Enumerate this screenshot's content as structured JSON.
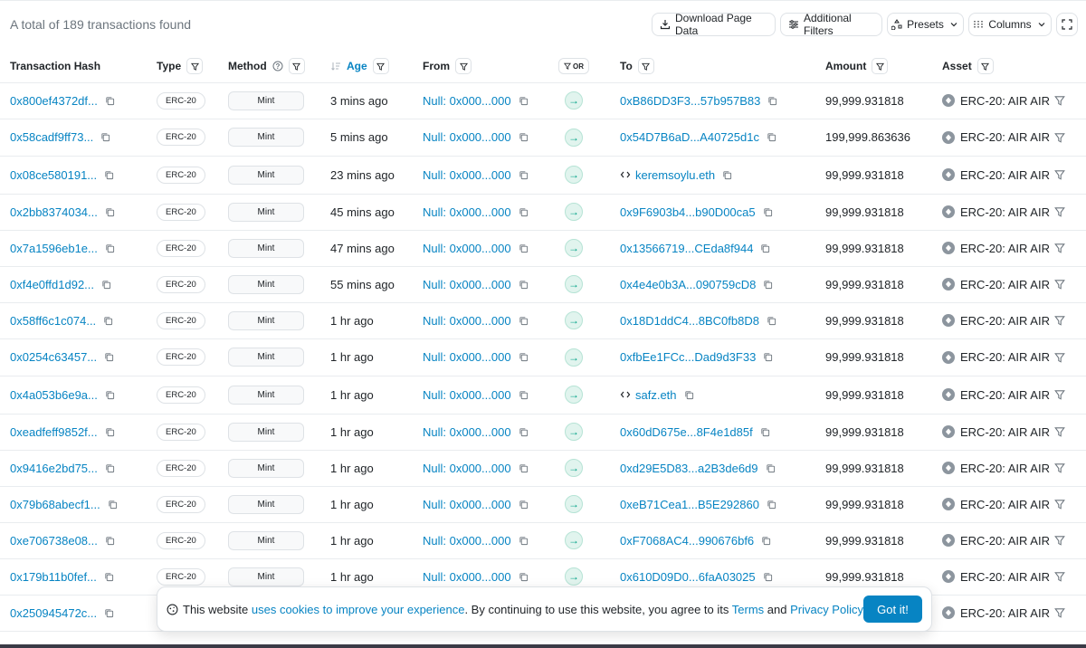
{
  "summary": "A total of 189 transactions found",
  "toolbar": {
    "download": "Download Page Data",
    "filters": "Additional Filters",
    "presets": "Presets",
    "columns": "Columns"
  },
  "columns": {
    "hash": "Transaction Hash",
    "type": "Type",
    "method": "Method",
    "age": "Age",
    "from": "From",
    "or": "OR",
    "to": "To",
    "amount": "Amount",
    "asset": "Asset"
  },
  "rows": [
    {
      "hash": "0x800ef4372df...",
      "type": "ERC-20",
      "method": "Mint",
      "age": "3 mins ago",
      "from": "Null: 0x000...000",
      "to": "0xB86DD3F3...57b957B83",
      "to_ens": false,
      "amount": "99,999.931818",
      "asset": "ERC-20: AIR AIR"
    },
    {
      "hash": "0x58cadf9ff73...",
      "type": "ERC-20",
      "method": "Mint",
      "age": "5 mins ago",
      "from": "Null: 0x000...000",
      "to": "0x54D7B6aD...A40725d1c",
      "to_ens": false,
      "amount": "199,999.863636",
      "asset": "ERC-20: AIR AIR"
    },
    {
      "hash": "0x08ce580191...",
      "type": "ERC-20",
      "method": "Mint",
      "age": "23 mins ago",
      "from": "Null: 0x000...000",
      "to": "keremsoylu.eth",
      "to_ens": true,
      "amount": "99,999.931818",
      "asset": "ERC-20: AIR AIR"
    },
    {
      "hash": "0x2bb8374034...",
      "type": "ERC-20",
      "method": "Mint",
      "age": "45 mins ago",
      "from": "Null: 0x000...000",
      "to": "0x9F6903b4...b90D00ca5",
      "to_ens": false,
      "amount": "99,999.931818",
      "asset": "ERC-20: AIR AIR"
    },
    {
      "hash": "0x7a1596eb1e...",
      "type": "ERC-20",
      "method": "Mint",
      "age": "47 mins ago",
      "from": "Null: 0x000...000",
      "to": "0x13566719...CEda8f944",
      "to_ens": false,
      "amount": "99,999.931818",
      "asset": "ERC-20: AIR AIR"
    },
    {
      "hash": "0xf4e0ffd1d92...",
      "type": "ERC-20",
      "method": "Mint",
      "age": "55 mins ago",
      "from": "Null: 0x000...000",
      "to": "0x4e4e0b3A...090759cD8",
      "to_ens": false,
      "amount": "99,999.931818",
      "asset": "ERC-20: AIR AIR"
    },
    {
      "hash": "0x58ff6c1c074...",
      "type": "ERC-20",
      "method": "Mint",
      "age": "1 hr ago",
      "from": "Null: 0x000...000",
      "to": "0x18D1ddC4...8BC0fb8D8",
      "to_ens": false,
      "amount": "99,999.931818",
      "asset": "ERC-20: AIR AIR"
    },
    {
      "hash": "0x0254c63457...",
      "type": "ERC-20",
      "method": "Mint",
      "age": "1 hr ago",
      "from": "Null: 0x000...000",
      "to": "0xfbEe1FCc...Dad9d3F33",
      "to_ens": false,
      "amount": "99,999.931818",
      "asset": "ERC-20: AIR AIR"
    },
    {
      "hash": "0x4a053b6e9a...",
      "type": "ERC-20",
      "method": "Mint",
      "age": "1 hr ago",
      "from": "Null: 0x000...000",
      "to": "safz.eth",
      "to_ens": true,
      "amount": "99,999.931818",
      "asset": "ERC-20: AIR AIR"
    },
    {
      "hash": "0xeadfeff9852f...",
      "type": "ERC-20",
      "method": "Mint",
      "age": "1 hr ago",
      "from": "Null: 0x000...000",
      "to": "0x60dD675e...8F4e1d85f",
      "to_ens": false,
      "amount": "99,999.931818",
      "asset": "ERC-20: AIR AIR"
    },
    {
      "hash": "0x9416e2bd75...",
      "type": "ERC-20",
      "method": "Mint",
      "age": "1 hr ago",
      "from": "Null: 0x000...000",
      "to": "0xd29E5D83...a2B3de6d9",
      "to_ens": false,
      "amount": "99,999.931818",
      "asset": "ERC-20: AIR AIR"
    },
    {
      "hash": "0x79b68abecf1...",
      "type": "ERC-20",
      "method": "Mint",
      "age": "1 hr ago",
      "from": "Null: 0x000...000",
      "to": "0xeB71Cea1...B5E292860",
      "to_ens": false,
      "amount": "99,999.931818",
      "asset": "ERC-20: AIR AIR"
    },
    {
      "hash": "0xe706738e08...",
      "type": "ERC-20",
      "method": "Mint",
      "age": "1 hr ago",
      "from": "Null: 0x000...000",
      "to": "0xF7068AC4...990676bf6",
      "to_ens": false,
      "amount": "99,999.931818",
      "asset": "ERC-20: AIR AIR"
    },
    {
      "hash": "0x179b11b0fef...",
      "type": "ERC-20",
      "method": "Mint",
      "age": "1 hr ago",
      "from": "Null: 0x000...000",
      "to": "0x610D09D0...6faA03025",
      "to_ens": false,
      "amount": "99,999.931818",
      "asset": "ERC-20: AIR AIR"
    },
    {
      "hash": "0x250945472c...",
      "type": "",
      "method": "",
      "age": "",
      "from": "",
      "to": "",
      "to_ens": false,
      "amount": "",
      "asset": "ERC-20: AIR AIR"
    }
  ],
  "cookie": {
    "prefix": "This website ",
    "link1": "uses cookies to improve your experience",
    "middle": ". By continuing to use this website, you agree to its ",
    "link2": "Terms",
    "and": " and ",
    "link3": "Privacy Policy",
    "end": ".",
    "button": "Got it!"
  },
  "colors": {
    "link": "#0784c3",
    "arrow_bg": "#e1f4ee",
    "arrow": "#00a186"
  }
}
